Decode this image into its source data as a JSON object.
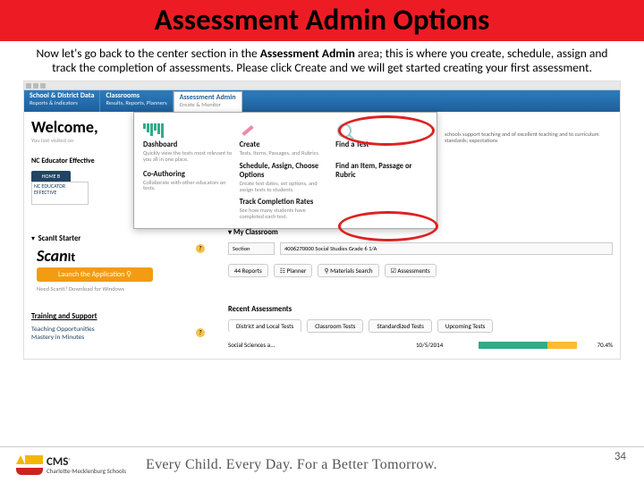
{
  "slide": {
    "title": "Assessment Admin Options",
    "intro_before": "Now let's go back to the center section in the ",
    "intro_bold": "Assessment Admin",
    "intro_after": " area; this is where you create, schedule, assign and track the completion of assessments.  Please click Create and we will get started creating your first assessment.",
    "page_number": "34"
  },
  "footer": {
    "brand_main": "CMS",
    "brand_sub": "Charlotte-Mecklenburg Schools",
    "tagline": "Every Child. Every Day. For a Better Tomorrow."
  },
  "screenshot": {
    "nav": [
      {
        "t": "School & District Data",
        "s": "Reports & Indicators"
      },
      {
        "t": "Classrooms",
        "s": "Results, Reports, Planners"
      },
      {
        "t": "Assessment Admin",
        "s": "Create & Monitor"
      }
    ],
    "welcome": "Welcome,",
    "welcome_sub": "You last visited on",
    "nee": "NC Educator Effective",
    "hometab": "HOME B",
    "neebox": "NC EDUCATOR\nEFFECTIVE",
    "dropdown": {
      "col1": {
        "h1": "Dashboard",
        "p1": "Quickly view the tests most relevant to you all in one place.",
        "h2": "Co-Authoring",
        "p2": "Collaborate with other educators on tests."
      },
      "col2": {
        "h1": "Create",
        "p1": "Tests, Items, Passages, and Rubrics",
        "h2": "Schedule, Assign, Choose Options",
        "p2": "Create test dates, set options, and assign tests to students.",
        "h3": "Track Completion Rates",
        "p3": "See how many students have completed each test."
      },
      "col3": {
        "h1": "Find a Test",
        "h2": "Find an Item, Passage or Rubric"
      }
    },
    "rpanel": "schools support teaching and of excellent teaching and to curriculum standards; expectations",
    "scanit": {
      "label": "ScanIt Starter",
      "logo1": "Scan",
      "logo2": "It",
      "btn": "Launch the Application",
      "note": "Need ScanIt? Download for Windows"
    },
    "myclass": {
      "title": "My Classroom",
      "section_label": "Section",
      "section_val": "4006270000 Social Studies Grade 6  1/A",
      "buttons": [
        "44 Reports",
        "Planner",
        "Materials Search",
        "Assessments"
      ]
    },
    "train": {
      "title": "Training and Support",
      "l1": "Teaching Opportunities",
      "l2": "Mastery in Minutes"
    },
    "recent": {
      "title": "Recent Assessments",
      "tabs": [
        "District and Local Tests",
        "Classroom Tests",
        "Standardized Tests",
        "Upcoming Tests"
      ],
      "row": {
        "name": "Social Sciences a...",
        "date": "10/5/2014",
        "pct": "70.4%"
      }
    }
  }
}
